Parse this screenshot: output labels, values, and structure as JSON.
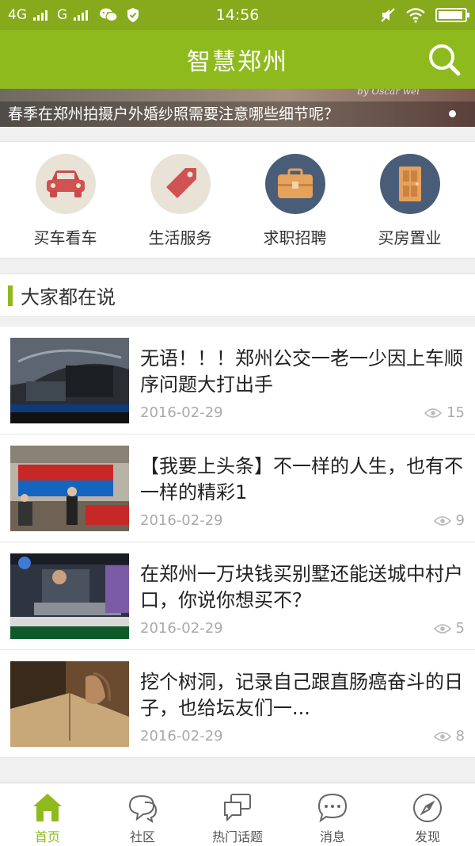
{
  "status_bar": {
    "network1": "4G",
    "network2": "G",
    "time": "14:56",
    "battery_level_pct": 95
  },
  "app_bar": {
    "title": "智慧郑州"
  },
  "banner": {
    "caption": "春季在郑州拍摄户外婚纱照需要注意哪些细节呢？",
    "decor_text": "by Oscar wei"
  },
  "categories": [
    {
      "label": "买车看车",
      "icon": "car-icon",
      "color": "#e8e3d6"
    },
    {
      "label": "生活服务",
      "icon": "tag-icon",
      "color": "#e8e3d6"
    },
    {
      "label": "求职招聘",
      "icon": "briefcase-icon",
      "color": "#4a5d78"
    },
    {
      "label": "买房置业",
      "icon": "door-icon",
      "color": "#4a5d78"
    }
  ],
  "section": {
    "title": "大家都在说"
  },
  "news": [
    {
      "title": "无语！！！郑州公交一老一少因上车顺序问题大打出手",
      "date": "2016-02-29",
      "views": "15"
    },
    {
      "title": "【我要上头条】不一样的人生，也有不一样的精彩1",
      "date": "2016-02-29",
      "views": "9"
    },
    {
      "title": "在郑州一万块钱买别墅还能送城中村户口，你说你想买不？",
      "date": "2016-02-29",
      "views": "5"
    },
    {
      "title": "挖个树洞，记录自己跟直肠癌奋斗的日子，也给坛友们一...",
      "date": "2016-02-29",
      "views": "8"
    }
  ],
  "tabs": [
    {
      "label": "首页",
      "icon": "home-icon",
      "active": true
    },
    {
      "label": "社区",
      "icon": "chat-bubbles-icon",
      "active": false
    },
    {
      "label": "热门话题",
      "icon": "topic-bubbles-icon",
      "active": false
    },
    {
      "label": "消息",
      "icon": "message-icon",
      "active": false
    },
    {
      "label": "发现",
      "icon": "compass-icon",
      "active": false
    }
  ],
  "colors": {
    "brand": "#8fba1e",
    "status_bar": "#86aa1b",
    "text": "#222222",
    "muted": "#aaaaaa"
  }
}
